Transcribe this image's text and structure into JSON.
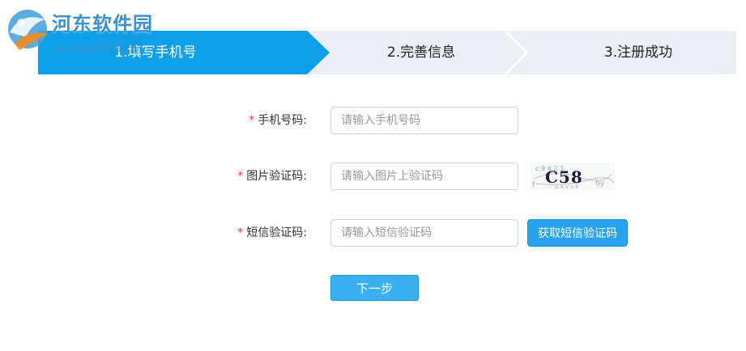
{
  "watermark": {
    "title": "河东软件园",
    "url": "www.pc0359.cn"
  },
  "steps": [
    {
      "label": "1.填写手机号",
      "active": true
    },
    {
      "label": "2.完善信息",
      "active": false
    },
    {
      "label": "3.注册成功",
      "active": false
    }
  ],
  "form": {
    "required_mark": "*",
    "phone": {
      "label": "手机号码:",
      "placeholder": "请输入手机号码",
      "value": ""
    },
    "captcha": {
      "label": "图片验证码:",
      "placeholder": "请输入图片上验证码",
      "value": "",
      "image_text": "C58"
    },
    "sms": {
      "label": "短信验证码:",
      "placeholder": "请输入短信验证码",
      "value": "",
      "button_label": "获取短信验证码"
    },
    "next_label": "下一步"
  },
  "colors": {
    "accent": "#0e9fe6",
    "button": "#2aa3ee",
    "step_bg": "#ebeef2",
    "required": "#ee3333",
    "watermark": "#3a8fd0"
  },
  "icons": {
    "logo": "hedong-logo-icon"
  }
}
